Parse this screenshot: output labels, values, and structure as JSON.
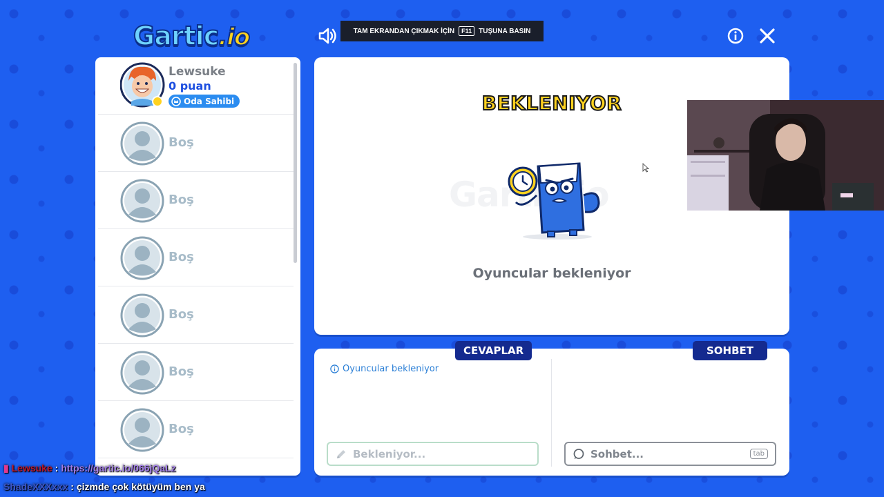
{
  "header": {
    "logo_text": "Gartic",
    "logo_suffix": ".io",
    "fullscreen_banner": {
      "before": "TAM EKRANDAN ÇIKMAK İÇİN",
      "key": "F11",
      "after": "TUŞUNA BASIN"
    }
  },
  "players": {
    "owner": {
      "name": "Lewsuke",
      "points": "0 puan",
      "badge": "Oda Sahibi"
    },
    "empty_slots": [
      "Boş",
      "Boş",
      "Boş",
      "Boş",
      "Boş",
      "Boş"
    ]
  },
  "game": {
    "status_title": "BEKLENIYOR",
    "watermark": "Gartic.io",
    "status_subtitle": "Oyuncular bekleniyor"
  },
  "answers": {
    "tab_label": "CEVAPLAR",
    "info_text": "Oyuncular bekleniyor",
    "input_placeholder": "Bekleniyor..."
  },
  "chat": {
    "tab_label": "SOHBET",
    "input_placeholder": "Sohbet...",
    "shortcut_hint": "tab"
  },
  "stream_chat": [
    {
      "user": "Lewsuke",
      "sep": " : ",
      "message": "https://gartic.io/066jQaLz"
    },
    {
      "user": "ShadeXXXxxx",
      "sep": " : ",
      "message": "çizmde çok kötüyüm ben ya"
    }
  ],
  "colors": {
    "background": "#1e5ff0",
    "accent_dark": "#142a8f",
    "title_yellow": "#ffd21f",
    "info_blue": "#2b7fd6"
  }
}
